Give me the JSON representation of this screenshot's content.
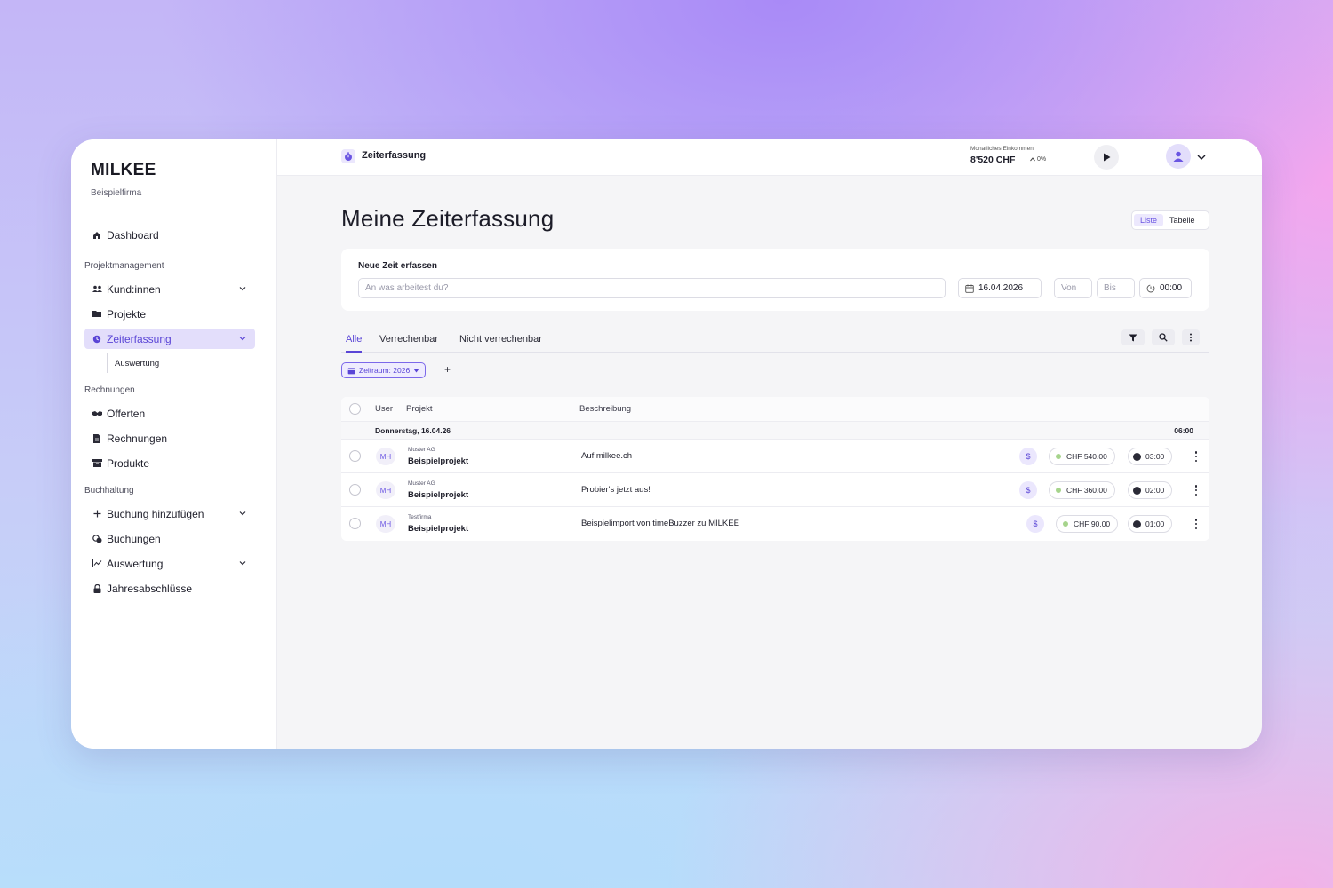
{
  "app": {
    "logo": "MILKEE",
    "company": "Beispielfirma"
  },
  "sidebar": {
    "dashboard": "Dashboard",
    "section_project": "Projektmanagement",
    "clients": "Kund:innen",
    "projects": "Projekte",
    "timetracking": "Zeiterfassung",
    "timetracking_sub": "Auswertung",
    "section_invoices": "Rechnungen",
    "offers": "Offerten",
    "invoices": "Rechnungen",
    "products": "Produkte",
    "section_accounting": "Buchhaltung",
    "add_booking": "Buchung hinzufügen",
    "bookings": "Buchungen",
    "reports": "Auswertung",
    "annual": "Jahresabschlüsse"
  },
  "topbar": {
    "title": "Zeiterfassung",
    "income_label": "Monatliches Einkommen",
    "income_value": "8'520 CHF",
    "income_trend": "0%"
  },
  "page": {
    "title": "Meine Zeiterfassung",
    "view_list": "Liste",
    "view_table": "Tabelle"
  },
  "new_entry": {
    "label": "Neue Zeit erfassen",
    "task_placeholder": "An was arbeitest du?",
    "date": "16.04.2026",
    "from_placeholder": "Von",
    "to_placeholder": "Bis",
    "duration": "00:00"
  },
  "tabs": {
    "all": "Alle",
    "billable": "Verrechenbar",
    "nonbillable": "Nicht verrechenbar"
  },
  "filter_chip": "Zeitraum: 2026",
  "add_filter": "+",
  "table": {
    "headers": {
      "user": "User",
      "project": "Projekt",
      "description": "Beschreibung"
    },
    "group": {
      "date": "Donnerstag, 16.04.26",
      "total": "06:00"
    },
    "rows": [
      {
        "initials": "MH",
        "customer": "Muster AG",
        "project": "Beispielprojekt",
        "description": "Auf milkee.ch",
        "billable": "$",
        "amount": "CHF 540.00",
        "duration": "03:00"
      },
      {
        "initials": "MH",
        "customer": "Muster AG",
        "project": "Beispielprojekt",
        "description": "Probier's jetzt aus!",
        "billable": "$",
        "amount": "CHF 360.00",
        "duration": "02:00"
      },
      {
        "initials": "MH",
        "customer": "Testfirma",
        "project": "Beispielprojekt",
        "description": "Beispielimport von timeBuzzer zu MILKEE",
        "billable": "$",
        "amount": "CHF 90.00",
        "duration": "01:00"
      }
    ]
  },
  "colors": {
    "accent": "#5a45d6",
    "accent_light": "#e3defb",
    "billable_dot": "#a6d48c"
  }
}
